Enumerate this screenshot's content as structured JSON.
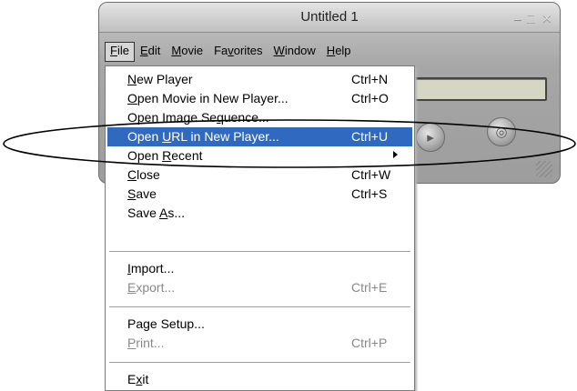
{
  "window": {
    "title": "Untitled 1",
    "controls": {
      "minimize": "–",
      "maximize": "□",
      "close": "✕"
    }
  },
  "menubar": {
    "items": [
      {
        "label_pre": "",
        "label_key": "F",
        "label_post": "ile"
      },
      {
        "label_pre": "",
        "label_key": "E",
        "label_post": "dit"
      },
      {
        "label_pre": "",
        "label_key": "M",
        "label_post": "ovie"
      },
      {
        "label_pre": "Fa",
        "label_key": "v",
        "label_post": "orites"
      },
      {
        "label_pre": "",
        "label_key": "W",
        "label_post": "indow"
      },
      {
        "label_pre": "",
        "label_key": "H",
        "label_post": "elp"
      }
    ]
  },
  "file_menu": {
    "items": [
      {
        "label_pre": "",
        "label_key": "N",
        "label_post": "ew Player",
        "shortcut": "Ctrl+N"
      },
      {
        "label_pre": "",
        "label_key": "O",
        "label_post": "pen Movie in New Player...",
        "shortcut": "Ctrl+O"
      },
      {
        "label_pre": "Open Image Se",
        "label_key": "q",
        "label_post": "uence...",
        "shortcut": ""
      },
      {
        "label_pre": "Open ",
        "label_key": "U",
        "label_post": "RL in New Player...",
        "shortcut": "Ctrl+U"
      },
      {
        "label_pre": "Open ",
        "label_key": "R",
        "label_post": "ecent",
        "shortcut": ""
      },
      {
        "label_pre": "",
        "label_key": "C",
        "label_post": "lose",
        "shortcut": "Ctrl+W"
      },
      {
        "label_pre": "",
        "label_key": "S",
        "label_post": "ave",
        "shortcut": "Ctrl+S"
      },
      {
        "label_pre": "Save ",
        "label_key": "A",
        "label_post": "s...",
        "shortcut": ""
      },
      {
        "label_pre": "",
        "label_key": "I",
        "label_post": "mport...",
        "shortcut": ""
      },
      {
        "label_pre": "",
        "label_key": "E",
        "label_post": "xport...",
        "shortcut": "Ctrl+E"
      },
      {
        "label_pre": "Pa",
        "label_key": "g",
        "label_post": "e Setup...",
        "shortcut": ""
      },
      {
        "label_pre": "",
        "label_key": "P",
        "label_post": "rint...",
        "shortcut": "Ctrl+P"
      },
      {
        "label_pre": "E",
        "label_key": "x",
        "label_post": "it",
        "shortcut": ""
      }
    ]
  },
  "colors": {
    "highlight": "#2f6ac0",
    "disabled_text": "#888888"
  }
}
